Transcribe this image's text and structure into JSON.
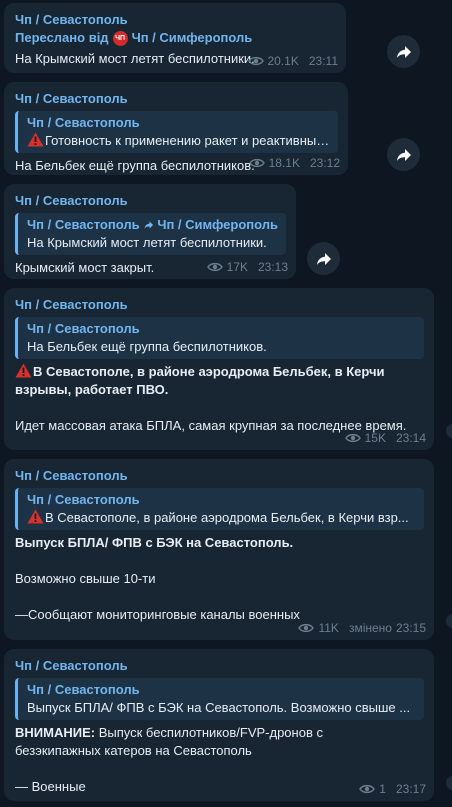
{
  "messages": [
    {
      "sender": "Чп / Севастополь",
      "forwarded_prefix": "Переслано від",
      "forwarded_badge": "ЧП",
      "forwarded_source": "Чп / Симферополь",
      "text": "На Крымский мост летят беспилотники.",
      "views": "20.1K",
      "time": "23:11"
    },
    {
      "sender": "Чп / Севастополь",
      "reply_name": "Чп / Севастополь",
      "reply_text": "Готовность к применению ракет и реактивных ...",
      "text": "На Бельбек ещё группа беспилотников.",
      "views": "18.1K",
      "time": "23:12"
    },
    {
      "sender": "Чп / Севастополь",
      "reply_name_from": "Чп / Севастополь",
      "reply_name_to": "Чп / Симферополь",
      "reply_text": "На Крымский мост летят беспилотники.",
      "text": "Крымский мост закрыт.",
      "views": "17K",
      "time": "23:13"
    },
    {
      "sender": "Чп / Севастополь",
      "reply_name": "Чп / Севастополь",
      "reply_text": "На Бельбек ещё группа беспилотников.",
      "bold_line1": "В Севастополе, в районе аэродрома Бельбек, в Керчи",
      "bold_line2": "взрывы, работает ПВО.",
      "text2": "Идет массовая атака БПЛА,  самая крупная за последнее время.",
      "views": "15K",
      "time": "23:14"
    },
    {
      "sender": "Чп / Севастополь",
      "reply_name": "Чп / Севастополь",
      "reply_text": "В Севастополе, в районе аэродрома Бельбек, в Керчи взр...",
      "bold_line": "Выпуск БПЛА/ ФПВ с БЭК на Севастополь.",
      "text2": "Возможно свыше 10-ти",
      "text3": "—Сообщают мониторинговые каналы военных",
      "views": "11K",
      "edited": "змінено",
      "time": "23:15"
    },
    {
      "sender": "Чп / Севастополь",
      "reply_name": "Чп / Севастополь",
      "reply_text": "Выпуск БПЛА/ ФПВ с БЭК на Севастополь.  Возможно свыше ...",
      "bold_prefix": "ВНИМАНИЕ:",
      "line1_rest": " Выпуск беспилотников/FVP-дронов с",
      "line2": "безэкипажных катеров на Севастополь",
      "text3": "— Военные",
      "views": "1",
      "time": "23:17"
    }
  ],
  "colors": {
    "background": "#0e1621",
    "bubble": "#182533",
    "accent": "#71b5ee",
    "meta": "#6d7f8f"
  }
}
